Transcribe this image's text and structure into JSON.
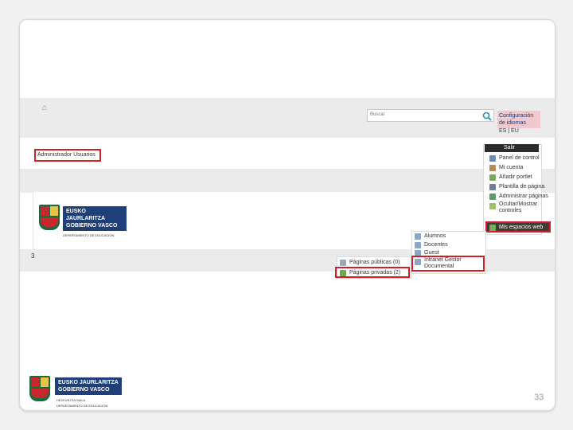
{
  "header": {
    "search_placeholder": "Buscar",
    "config_link": "Configuración de idiomas",
    "languages": "ES | EU"
  },
  "admin_link": "Administrador Usuarios",
  "logo": {
    "line1": "EUSKO JAURLARITZA",
    "line2": "GOBIERNO VASCO",
    "sub1": "HEZKUNTZA SAILA",
    "sub2": "DEPARTAMENTO DE EDUCACIÓN"
  },
  "dock": {
    "exit": "Salir",
    "items": [
      "Panel de control",
      "Mi cuenta",
      "Añadir portlet",
      "Plantilla de página",
      "Administrar páginas",
      "Ocultar/Mostrar controles",
      "Mis espacios web"
    ]
  },
  "submenu": {
    "items": [
      "Alumnos",
      "Docentes",
      "Guest",
      "Intranet Gestor Documental"
    ]
  },
  "pages_menu": {
    "public": "Páginas públicas (0)",
    "private": "Páginas privadas (2)"
  },
  "row_number": "3",
  "slide_number": "33",
  "colors": {
    "highlight": "#d11f2a",
    "band": "#ebebeb",
    "shield_green": "#1a6b3a",
    "banner_blue": "#1f3f7a"
  }
}
